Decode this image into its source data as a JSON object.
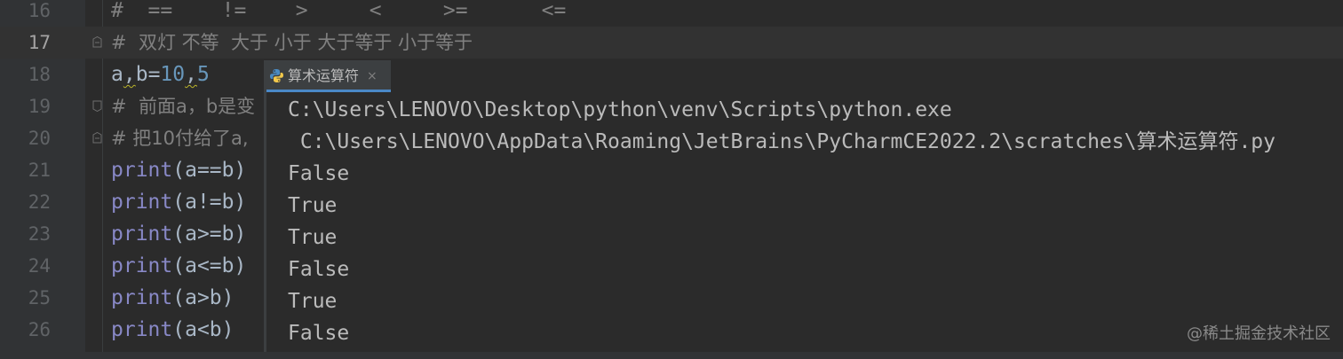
{
  "editor": {
    "lines": [
      {
        "number": "16",
        "code": "#  ==    !=    >     <     >=      <="
      },
      {
        "number": "17",
        "code": "#  双灯 不等  大于 小于 大于等于 小于等于"
      },
      {
        "number": "18",
        "a": "a",
        "comma1": ",",
        "b": "b=",
        "n1": "10",
        "comma2": ",",
        "n2": "5"
      },
      {
        "number": "19",
        "code": "#  前面a，b是变"
      },
      {
        "number": "20",
        "code": "# 把10付给了a,"
      },
      {
        "number": "21",
        "fn": "print",
        "args": "(a==b)"
      },
      {
        "number": "22",
        "fn": "print",
        "args": "(a!=b)"
      },
      {
        "number": "23",
        "fn": "print",
        "args": "(a>=b)"
      },
      {
        "number": "24",
        "fn": "print",
        "args": "(a<=b)"
      },
      {
        "number": "25",
        "fn": "print",
        "args": "(a>b)"
      },
      {
        "number": "26",
        "fn": "print",
        "args": "(a<b)"
      }
    ]
  },
  "run_popup": {
    "tab_label": "算术运算符",
    "tab_close": "×",
    "output": [
      "C:\\Users\\LENOVO\\Desktop\\python\\venv\\Scripts\\python.exe",
      " C:\\Users\\LENOVO\\AppData\\Roaming\\JetBrains\\PyCharmCE2022.2\\scratches\\算术运算符.py",
      "False",
      "True",
      "True",
      "False",
      "True",
      "False"
    ]
  },
  "watermark": "@稀土掘金技术社区",
  "colors": {
    "background": "#2b2b2b",
    "keyword": "#8888c6",
    "number": "#6897bb",
    "comment": "#808080",
    "accent_tab": "#4a88c7"
  }
}
